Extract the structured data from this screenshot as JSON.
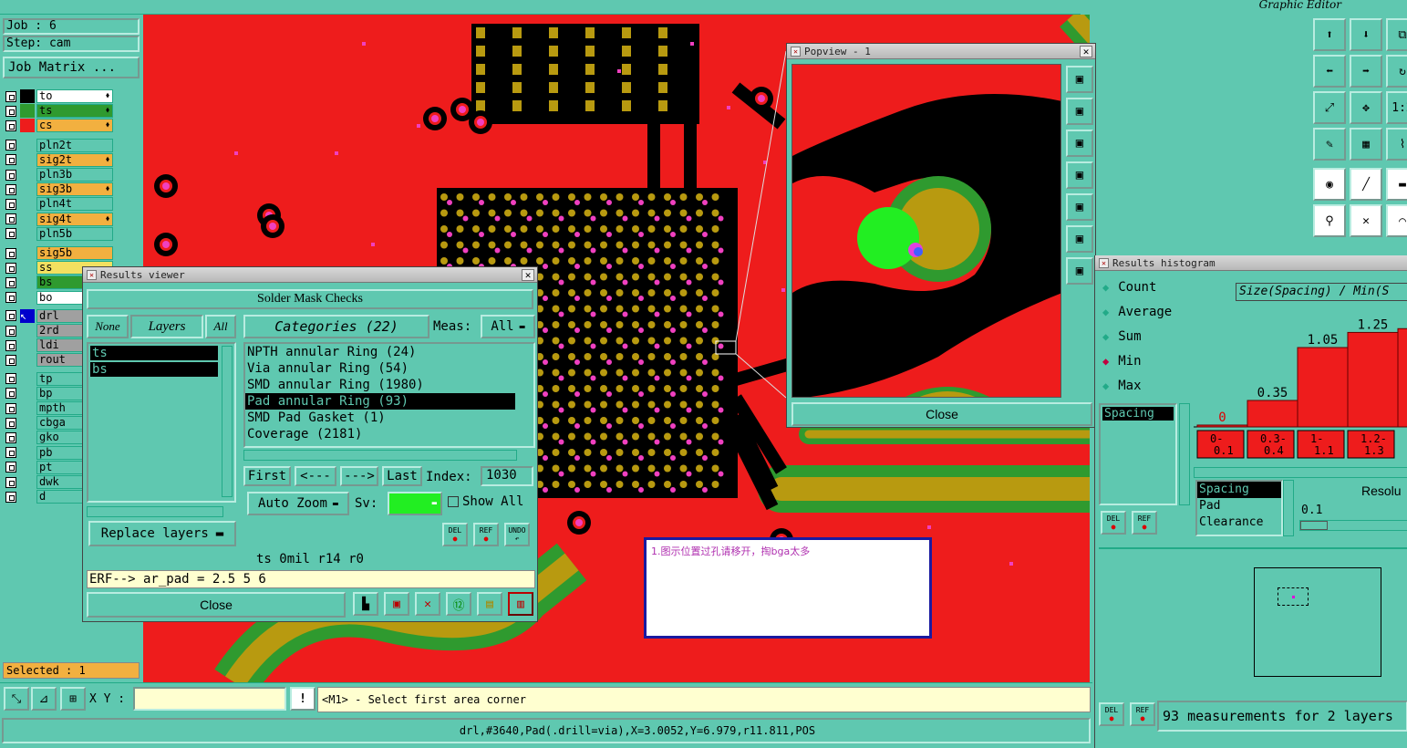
{
  "job_panel": {
    "job": "Job : 6",
    "step": "Step: cam",
    "matrix_button": "Job Matrix ...",
    "selected": "Selected : 1"
  },
  "layers": [
    {
      "name": "to",
      "color": "#000000",
      "box": "#ffffff",
      "star": "⬧"
    },
    {
      "name": "ts",
      "color": "#2f9a2f",
      "box": "#2f9a2f",
      "star": "⬧"
    },
    {
      "name": "cs",
      "color": "#ee1c1c",
      "box": "#f2b040",
      "star": "⬧"
    },
    {
      "name": "pln2t",
      "color": "#5fc8b0",
      "box": "#5fc8b0",
      "star": ""
    },
    {
      "name": "sig2t",
      "color": "#5fc8b0",
      "box": "#f2b040",
      "star": "⬧"
    },
    {
      "name": "pln3b",
      "color": "#5fc8b0",
      "box": "#5fc8b0",
      "star": ""
    },
    {
      "name": "sig3b",
      "color": "#5fc8b0",
      "box": "#f2b040",
      "star": "⬧"
    },
    {
      "name": "pln4t",
      "color": "#5fc8b0",
      "box": "#5fc8b0",
      "star": ""
    },
    {
      "name": "sig4t",
      "color": "#5fc8b0",
      "box": "#f2b040",
      "star": "⬧"
    },
    {
      "name": "pln5b",
      "color": "#5fc8b0",
      "box": "#5fc8b0",
      "star": ""
    },
    {
      "name": "sig5b",
      "color": "#5fc8b0",
      "box": "#f2b040",
      "star": ""
    },
    {
      "name": "ss",
      "color": "#5fc8b0",
      "box": "#f2e060",
      "star": ""
    },
    {
      "name": "bs",
      "color": "#5fc8b0",
      "box": "#2f9a2f",
      "star": ""
    },
    {
      "name": "bo",
      "color": "#5fc8b0",
      "box": "#ffffff",
      "star": ""
    },
    {
      "name": "drl",
      "color": "#0000cc",
      "box": "#a0a0a0",
      "star": ""
    },
    {
      "name": "2rd",
      "color": "#5fc8b0",
      "box": "#a0a0a0",
      "star": ""
    },
    {
      "name": "ldi",
      "color": "#5fc8b0",
      "box": "#a0a0a0",
      "star": ""
    },
    {
      "name": "rout",
      "color": "#5fc8b0",
      "box": "#a0a0a0",
      "star": ""
    },
    {
      "name": "tp",
      "color": "#5fc8b0",
      "box": "#5fc8b0",
      "star": ""
    },
    {
      "name": "bp",
      "color": "#5fc8b0",
      "box": "#5fc8b0",
      "star": ""
    },
    {
      "name": "mpth",
      "color": "#5fc8b0",
      "box": "#5fc8b0",
      "star": ""
    },
    {
      "name": "cbga",
      "color": "#5fc8b0",
      "box": "#5fc8b0",
      "star": ""
    },
    {
      "name": "gko",
      "color": "#5fc8b0",
      "box": "#5fc8b0",
      "star": ""
    },
    {
      "name": "pb",
      "color": "#5fc8b0",
      "box": "#5fc8b0",
      "star": ""
    },
    {
      "name": "pt",
      "color": "#5fc8b0",
      "box": "#5fc8b0",
      "star": ""
    },
    {
      "name": "dwk",
      "color": "#5fc8b0",
      "box": "#5fc8b0",
      "star": ""
    },
    {
      "name": "d",
      "color": "#5fc8b0",
      "box": "#5fc8b0",
      "star": ""
    }
  ],
  "graphic_editor_title": "Graphic Editor",
  "results_viewer": {
    "title": "Results viewer",
    "section": "Solder Mask Checks",
    "btn_none": "None",
    "btn_layers": "Layers",
    "btn_all": "All",
    "layers_list": [
      "ts",
      "bs"
    ],
    "categories_label": "Categories (22)",
    "meas_label": "Meas:",
    "meas_value": "All",
    "categories": [
      "NPTH annular Ring (24)",
      "Via annular Ring (54)",
      "SMD annular Ring (1980)",
      "Pad annular Ring (93)",
      "SMD Pad Gasket (1)",
      "Coverage (2181)"
    ],
    "selected_category": 3,
    "nav_first": "First",
    "nav_prev": "<---",
    "nav_next": "--->",
    "nav_last": "Last",
    "index_label": "Index:",
    "index_value": "1030",
    "auto_zoom": "Auto Zoom",
    "sv_label": "Sv:",
    "show_all": "Show All",
    "replace_layers": "Replace layers",
    "del": "DEL",
    "ref": "REF",
    "undo": "UNDO",
    "status": "ts 0mil   r14   r0",
    "erf": "ERF--> ar_pad = 2.5 5 6",
    "close": "Close"
  },
  "popview": {
    "title": "Popview - 1",
    "close": "Close"
  },
  "note": "1.图示位置过孔请移开，掏bga太多",
  "histogram": {
    "title": "Results histogram",
    "options": [
      "Count",
      "Average",
      "Sum",
      "Min",
      "Max"
    ],
    "selected_option": "Min",
    "chart_title": "Size(Spacing) / Min(S",
    "list": [
      "Spacing"
    ],
    "chart_data": {
      "type": "bar",
      "categories": [
        "0-0.1",
        "0.3-0.4",
        "1-1.1",
        "1.2-1.3",
        ""
      ],
      "values": [
        0,
        0.35,
        1.05,
        1.25,
        1.3
      ],
      "value_labels": [
        "0",
        "0.35",
        "1.05",
        "1.25",
        ""
      ]
    },
    "bin_labels": [
      [
        "0-",
        "0.1"
      ],
      [
        "0.3-",
        "0.4"
      ],
      [
        "1-",
        "1.1"
      ],
      [
        "1.2-",
        "1.3"
      ]
    ],
    "types": [
      "Spacing",
      "Pad",
      "Clearance"
    ],
    "resolution_label": "Resolu",
    "resolution_value": "0.1",
    "del": "DEL",
    "ref": "REF",
    "measurements": "93 measurements for 2 layers"
  },
  "bottom": {
    "xy_label": "X Y :",
    "xy_value": "",
    "prompt": "<M1> - Select first area corner",
    "info": "drl,#3640,Pad(.drill=via),X=3.0052,Y=6.979,r11.811,POS",
    "warn": "!"
  }
}
